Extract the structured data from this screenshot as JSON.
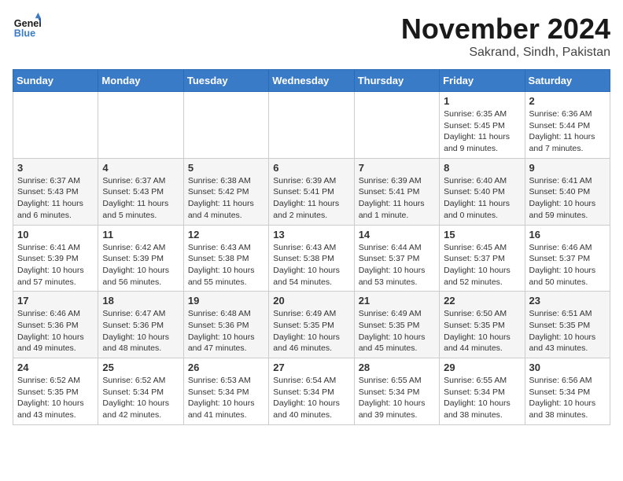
{
  "header": {
    "logo_line1": "General",
    "logo_line2": "Blue",
    "month": "November 2024",
    "location": "Sakrand, Sindh, Pakistan"
  },
  "weekdays": [
    "Sunday",
    "Monday",
    "Tuesday",
    "Wednesday",
    "Thursday",
    "Friday",
    "Saturday"
  ],
  "rows": [
    {
      "cells": [
        {
          "day": "",
          "info": ""
        },
        {
          "day": "",
          "info": ""
        },
        {
          "day": "",
          "info": ""
        },
        {
          "day": "",
          "info": ""
        },
        {
          "day": "",
          "info": ""
        },
        {
          "day": "1",
          "info": "Sunrise: 6:35 AM\nSunset: 5:45 PM\nDaylight: 11 hours and 9 minutes."
        },
        {
          "day": "2",
          "info": "Sunrise: 6:36 AM\nSunset: 5:44 PM\nDaylight: 11 hours and 7 minutes."
        }
      ]
    },
    {
      "cells": [
        {
          "day": "3",
          "info": "Sunrise: 6:37 AM\nSunset: 5:43 PM\nDaylight: 11 hours and 6 minutes."
        },
        {
          "day": "4",
          "info": "Sunrise: 6:37 AM\nSunset: 5:43 PM\nDaylight: 11 hours and 5 minutes."
        },
        {
          "day": "5",
          "info": "Sunrise: 6:38 AM\nSunset: 5:42 PM\nDaylight: 11 hours and 4 minutes."
        },
        {
          "day": "6",
          "info": "Sunrise: 6:39 AM\nSunset: 5:41 PM\nDaylight: 11 hours and 2 minutes."
        },
        {
          "day": "7",
          "info": "Sunrise: 6:39 AM\nSunset: 5:41 PM\nDaylight: 11 hours and 1 minute."
        },
        {
          "day": "8",
          "info": "Sunrise: 6:40 AM\nSunset: 5:40 PM\nDaylight: 11 hours and 0 minutes."
        },
        {
          "day": "9",
          "info": "Sunrise: 6:41 AM\nSunset: 5:40 PM\nDaylight: 10 hours and 59 minutes."
        }
      ]
    },
    {
      "cells": [
        {
          "day": "10",
          "info": "Sunrise: 6:41 AM\nSunset: 5:39 PM\nDaylight: 10 hours and 57 minutes."
        },
        {
          "day": "11",
          "info": "Sunrise: 6:42 AM\nSunset: 5:39 PM\nDaylight: 10 hours and 56 minutes."
        },
        {
          "day": "12",
          "info": "Sunrise: 6:43 AM\nSunset: 5:38 PM\nDaylight: 10 hours and 55 minutes."
        },
        {
          "day": "13",
          "info": "Sunrise: 6:43 AM\nSunset: 5:38 PM\nDaylight: 10 hours and 54 minutes."
        },
        {
          "day": "14",
          "info": "Sunrise: 6:44 AM\nSunset: 5:37 PM\nDaylight: 10 hours and 53 minutes."
        },
        {
          "day": "15",
          "info": "Sunrise: 6:45 AM\nSunset: 5:37 PM\nDaylight: 10 hours and 52 minutes."
        },
        {
          "day": "16",
          "info": "Sunrise: 6:46 AM\nSunset: 5:37 PM\nDaylight: 10 hours and 50 minutes."
        }
      ]
    },
    {
      "cells": [
        {
          "day": "17",
          "info": "Sunrise: 6:46 AM\nSunset: 5:36 PM\nDaylight: 10 hours and 49 minutes."
        },
        {
          "day": "18",
          "info": "Sunrise: 6:47 AM\nSunset: 5:36 PM\nDaylight: 10 hours and 48 minutes."
        },
        {
          "day": "19",
          "info": "Sunrise: 6:48 AM\nSunset: 5:36 PM\nDaylight: 10 hours and 47 minutes."
        },
        {
          "day": "20",
          "info": "Sunrise: 6:49 AM\nSunset: 5:35 PM\nDaylight: 10 hours and 46 minutes."
        },
        {
          "day": "21",
          "info": "Sunrise: 6:49 AM\nSunset: 5:35 PM\nDaylight: 10 hours and 45 minutes."
        },
        {
          "day": "22",
          "info": "Sunrise: 6:50 AM\nSunset: 5:35 PM\nDaylight: 10 hours and 44 minutes."
        },
        {
          "day": "23",
          "info": "Sunrise: 6:51 AM\nSunset: 5:35 PM\nDaylight: 10 hours and 43 minutes."
        }
      ]
    },
    {
      "cells": [
        {
          "day": "24",
          "info": "Sunrise: 6:52 AM\nSunset: 5:35 PM\nDaylight: 10 hours and 43 minutes."
        },
        {
          "day": "25",
          "info": "Sunrise: 6:52 AM\nSunset: 5:34 PM\nDaylight: 10 hours and 42 minutes."
        },
        {
          "day": "26",
          "info": "Sunrise: 6:53 AM\nSunset: 5:34 PM\nDaylight: 10 hours and 41 minutes."
        },
        {
          "day": "27",
          "info": "Sunrise: 6:54 AM\nSunset: 5:34 PM\nDaylight: 10 hours and 40 minutes."
        },
        {
          "day": "28",
          "info": "Sunrise: 6:55 AM\nSunset: 5:34 PM\nDaylight: 10 hours and 39 minutes."
        },
        {
          "day": "29",
          "info": "Sunrise: 6:55 AM\nSunset: 5:34 PM\nDaylight: 10 hours and 38 minutes."
        },
        {
          "day": "30",
          "info": "Sunrise: 6:56 AM\nSunset: 5:34 PM\nDaylight: 10 hours and 38 minutes."
        }
      ]
    }
  ]
}
